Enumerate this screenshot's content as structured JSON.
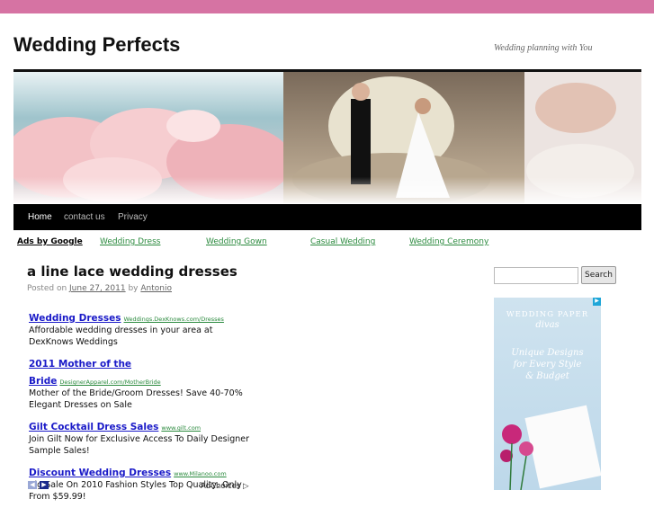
{
  "site": {
    "title": "Wedding Perfects",
    "description": "Wedding planning with You"
  },
  "nav": {
    "items": [
      "Home",
      "contact us",
      "Privacy"
    ]
  },
  "adbar": {
    "label": "Ads by Google",
    "links": [
      "Wedding Dress",
      "Wedding Gown",
      "Casual Wedding",
      "Wedding Ceremony"
    ]
  },
  "post": {
    "title": "a line lace wedding dresses",
    "posted_on": "Posted on",
    "date": "June 27, 2011",
    "by": "by",
    "author": "Antonio"
  },
  "ads": [
    {
      "title": "Wedding Dresses",
      "url": "Weddings.DexKnows.com/Dresses",
      "desc": "Affordable wedding dresses in your area at DexKnows Weddings"
    },
    {
      "title": "2011 Mother of the Bride",
      "url": "DesignerApparel.com/MotherBride",
      "desc": "Mother of the Bride/Groom Dresses! Save 40-70% Elegant Dresses on Sale"
    },
    {
      "title": "Gilt Cocktail Dress Sales",
      "url": "www.gilt.com",
      "desc": "Join Gilt Now for Exclusive Access To Daily Designer Sample Sales!"
    },
    {
      "title": "Discount Wedding Dresses",
      "url": "www.Milanoo.com",
      "desc": "Big Sale On 2010 Fashion Styles Top Quality, Only From $59.99!"
    }
  ],
  "adchoices": "AdChoices",
  "search": {
    "button": "Search",
    "value": ""
  },
  "sidebar_ad": {
    "brand_line1": "WEDDING PAPER",
    "brand_line2": "divas",
    "tagline": [
      "Unique Designs",
      "for Every Style",
      "& Budget"
    ]
  },
  "colors": {
    "topbar": "#d673a3",
    "nav": "#000000",
    "ad_title": "#1a1ac8",
    "ad_url": "#2b8a3e"
  }
}
